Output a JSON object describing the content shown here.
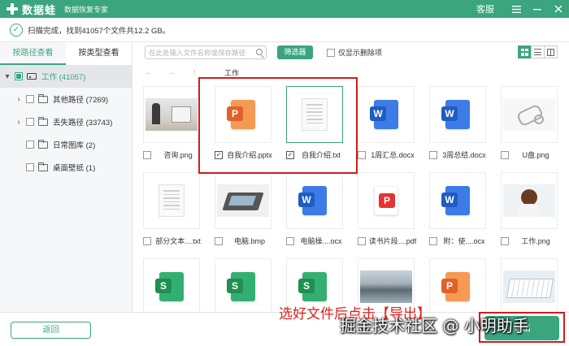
{
  "titlebar": {
    "app_name": "数据蛙",
    "app_subtitle": "数据恢复专家",
    "service": "客服",
    "menu_icon": "hamburger-icon",
    "min_icon": "minimize-icon",
    "close_icon": "close-icon"
  },
  "status": {
    "text": "扫描完成，找到41057个文件共12.2 GB。"
  },
  "sidebar": {
    "tabs": [
      {
        "label": "按路径查看",
        "active": true
      },
      {
        "label": "按类型查看",
        "active": false
      }
    ],
    "tree": [
      {
        "label": "工作 (41057)",
        "level": 0
      },
      {
        "label": "其他路径 (7269)",
        "level": 1
      },
      {
        "label": "丢失路径 (33743)",
        "level": 1
      },
      {
        "label": "日常图库 (2)",
        "level": 1
      },
      {
        "label": "桌面壁纸 (1)",
        "level": 1
      }
    ]
  },
  "toolbar": {
    "search_placeholder": "在此处输入文件名称或保存路径",
    "filter_label": "筛选器",
    "only_deleted_label": "仅显示删除项"
  },
  "breadcrumb": {
    "path": "工作"
  },
  "files": [
    {
      "name": "咨询.png",
      "type": "photo-office",
      "checked": false
    },
    {
      "name": "自我介绍.pptx",
      "type": "pptx",
      "checked": true
    },
    {
      "name": "自我介绍.txt",
      "type": "txt",
      "checked": true
    },
    {
      "name": "1周汇总.docx",
      "type": "docx",
      "checked": false
    },
    {
      "name": "3周总结.docx",
      "type": "docx",
      "checked": false
    },
    {
      "name": "U盘.png",
      "type": "photo-usb",
      "checked": false
    },
    {
      "name": "部分文本....txt",
      "type": "txt",
      "checked": false
    },
    {
      "name": "电脑.bmp",
      "type": "photo-laptop",
      "checked": false
    },
    {
      "name": "电脑操....ocx",
      "type": "docx",
      "checked": false
    },
    {
      "name": "读书片段....pdf",
      "type": "pdf",
      "checked": false
    },
    {
      "name": "附：使....ocx",
      "type": "docx",
      "checked": false
    },
    {
      "name": "工作.png",
      "type": "photo-girl",
      "checked": false
    },
    {
      "name": "",
      "type": "xlsx",
      "checked": false
    },
    {
      "name": "",
      "type": "xlsx",
      "checked": false
    },
    {
      "name": "",
      "type": "xlsx",
      "checked": false
    },
    {
      "name": "",
      "type": "photo-landscape",
      "checked": false
    },
    {
      "name": "",
      "type": "pptx",
      "checked": false
    },
    {
      "name": "",
      "type": "photo-keyboard",
      "checked": false
    }
  ],
  "footer": {
    "back_label": "返回",
    "export_label": "导出"
  },
  "annotation": "选好文件后点击【导出】",
  "watermark": "掘金技术社区 @ 小明助手",
  "colors": {
    "brand": "#3aa57f",
    "highlight_box": "#d11c1c"
  }
}
